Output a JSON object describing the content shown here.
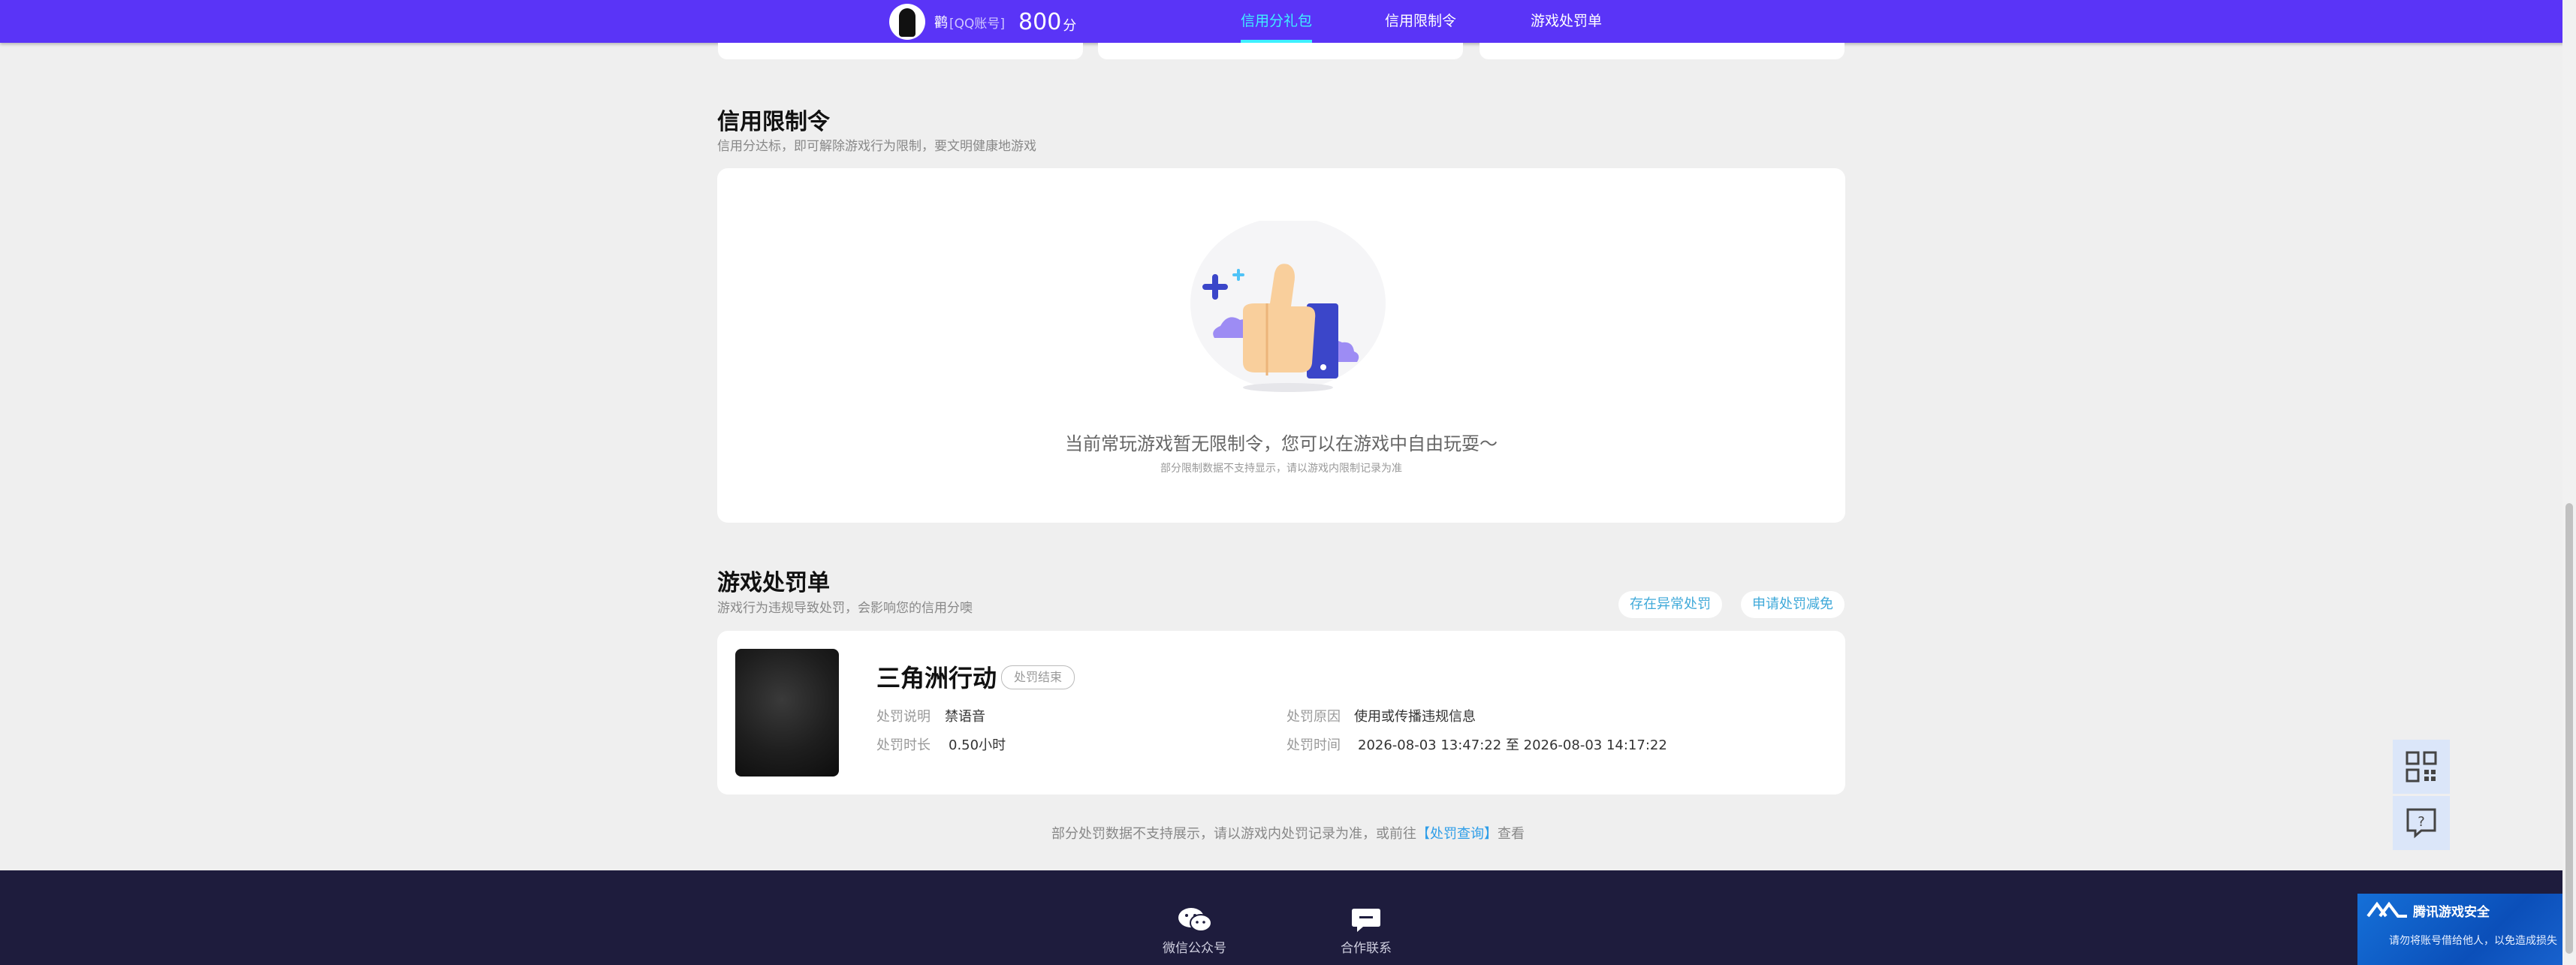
{
  "header": {
    "user_name": "鹳",
    "account_type": "[QQ账号]",
    "score": "800",
    "score_unit": "分",
    "nav": [
      {
        "label": "信用分礼包",
        "active": true
      },
      {
        "label": "信用限制令",
        "active": false
      },
      {
        "label": "游戏处罚单",
        "active": false
      }
    ]
  },
  "restriction": {
    "title": "信用限制令",
    "subtitle": "信用分达标，即可解除游戏行为限制，要文明健康地游戏",
    "empty_main": "当前常玩游戏暂无限制令，您可以在游戏中自由玩耍～",
    "empty_sub": "部分限制数据不支持显示，请以游戏内限制记录为准"
  },
  "penalty": {
    "title": "游戏处罚单",
    "subtitle": "游戏行为违规导致处罚，会影响您的信用分噢",
    "btn_abnormal": "存在异常处罚",
    "btn_reduce": "申请处罚减免",
    "record": {
      "game_name": "三角洲行动",
      "status": "处罚结束",
      "desc_label": "处罚说明",
      "desc_value": "禁语音",
      "duration_label": "处罚时长",
      "duration_value": "0.50小时",
      "reason_label": "处罚原因",
      "reason_value": "使用或传播违规信息",
      "time_label": "处罚时间",
      "time_value": "2026-08-03 13:47:22 至 2026-08-03 14:17:22"
    },
    "footnote_pre": "部分处罚数据不支持展示，请以游戏内处罚记录为准，或前往",
    "footnote_link": "【处罚查询】",
    "footnote_post": "查看"
  },
  "footer": {
    "wechat": "微信公众号",
    "contact": "合作联系"
  },
  "toast": {
    "title": "腾讯游戏安全",
    "text": "请勿将账号借给他人，以免造成损失"
  },
  "icons": {
    "avatar": "avatar",
    "qr": "qrcode-icon",
    "help": "help-chat-icon",
    "wechat": "wechat-icon",
    "chat": "chat-bubble-icon"
  },
  "colors": {
    "topbar": "#5a34f7",
    "active_nav": "#3ff0ff",
    "footer": "#1e1c3d",
    "link": "#2f9ee8"
  }
}
